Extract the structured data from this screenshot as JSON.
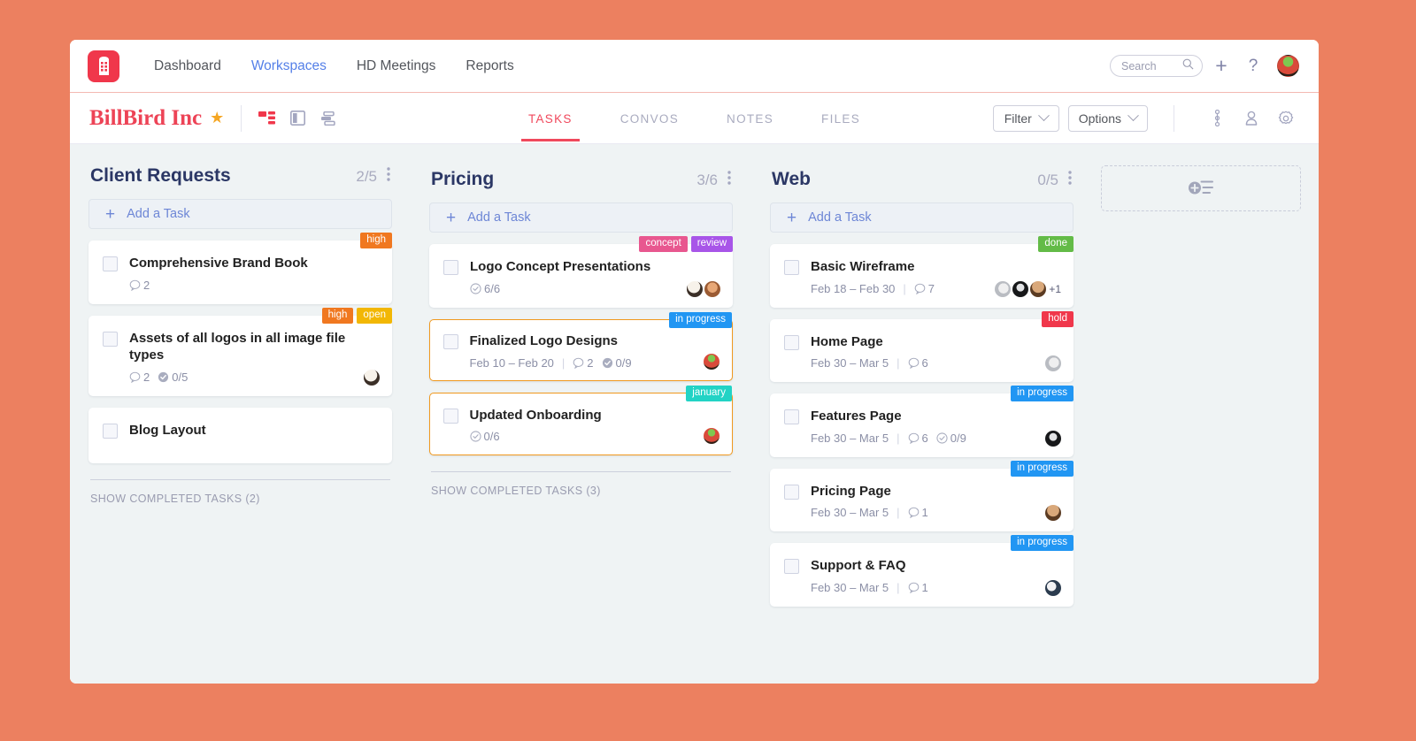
{
  "topnav": {
    "logo_icon": "building-logo-icon",
    "links": [
      {
        "label": "Dashboard",
        "active": false
      },
      {
        "label": "Workspaces",
        "active": true
      },
      {
        "label": "HD Meetings",
        "active": false
      },
      {
        "label": "Reports",
        "active": false
      }
    ],
    "search_placeholder": "Search",
    "add_label": "+",
    "help_label": "?"
  },
  "workspace": {
    "title": "BillBird Inc",
    "star": "★",
    "view_icons": [
      "board-view-icon",
      "split-view-icon",
      "list-view-icon"
    ],
    "tabs": [
      {
        "label": "TASKS",
        "active": true
      },
      {
        "label": "CONVOS",
        "active": false
      },
      {
        "label": "NOTES",
        "active": false
      },
      {
        "label": "FILES",
        "active": false
      }
    ],
    "filter_label": "Filter",
    "options_label": "Options"
  },
  "colors": {
    "brand_red": "#ed4356",
    "accent_orange": "#f0991f",
    "page_bg": "#ec8060",
    "board_bg": "#eff3f4",
    "link_blue": "#6d86d6",
    "tag_high": "#f07820",
    "tag_open": "#f2b705",
    "tag_concept": "#e8578f",
    "tag_review": "#a855e8",
    "tag_in_progress": "#2196f3",
    "tag_january": "#22d3c5",
    "tag_done": "#63bb47",
    "tag_hold": "#f0374b"
  },
  "columns": [
    {
      "title": "Client Requests",
      "count": "2/5",
      "add_task_label": "Add a Task",
      "show_completed": "SHOW COMPLETED TASKS (2)",
      "cards": [
        {
          "title": "Comprehensive Brand Book",
          "tags": [
            {
              "label": "high",
              "color": "#f07820"
            }
          ],
          "dates": "",
          "comments": "2",
          "subtasks": "",
          "highlight": false,
          "avatars": []
        },
        {
          "title": "Assets of all logos in all image file types",
          "tags": [
            {
              "label": "high",
              "color": "#f07820"
            },
            {
              "label": "open",
              "color": "#f2b705"
            }
          ],
          "dates": "",
          "comments": "2",
          "subtasks": "0/5",
          "highlight": false,
          "avatars": [
            "av-a"
          ]
        },
        {
          "title": "Blog Layout",
          "tags": [],
          "dates": "",
          "comments": "",
          "subtasks": "",
          "highlight": false,
          "avatars": []
        }
      ]
    },
    {
      "title": "Pricing",
      "count": "3/6",
      "add_task_label": "Add a Task",
      "show_completed": "SHOW COMPLETED TASKS (3)",
      "cards": [
        {
          "title": "Logo Concept Presentations",
          "tags": [
            {
              "label": "concept",
              "color": "#e8578f"
            },
            {
              "label": "review",
              "color": "#a855e8"
            }
          ],
          "dates": "",
          "comments": "",
          "subtasks": "6/6",
          "highlight": false,
          "avatars": [
            "av-a",
            "av-b"
          ]
        },
        {
          "title": "Finalized Logo Designs",
          "tags": [
            {
              "label": "in progress",
              "color": "#2196f3"
            }
          ],
          "dates": "Feb 10 – Feb 20",
          "comments": "2",
          "subtasks": "0/9",
          "highlight": true,
          "avatars": [
            "av-c"
          ]
        },
        {
          "title": "Updated Onboarding",
          "tags": [
            {
              "label": "january",
              "color": "#22d3c5"
            }
          ],
          "dates": "",
          "comments": "",
          "subtasks": "0/6",
          "highlight": true,
          "avatars": [
            "av-c"
          ]
        }
      ]
    },
    {
      "title": "Web",
      "count": "0/5",
      "add_task_label": "Add a Task",
      "show_completed": "",
      "cards": [
        {
          "title": "Basic Wireframe",
          "tags": [
            {
              "label": "done",
              "color": "#63bb47"
            }
          ],
          "dates": "Feb 18 – Feb 30",
          "comments": "7",
          "subtasks": "",
          "highlight": false,
          "avatars": [
            "av-d",
            "av-e",
            "av-f"
          ],
          "avatar_overflow": "+1"
        },
        {
          "title": "Home Page",
          "tags": [
            {
              "label": "hold",
              "color": "#f0374b"
            }
          ],
          "dates": "Feb 30 – Mar 5",
          "comments": "6",
          "subtasks": "",
          "highlight": false,
          "avatars": [
            "av-d"
          ]
        },
        {
          "title": "Features Page",
          "tags": [
            {
              "label": "in progress",
              "color": "#2196f3"
            }
          ],
          "dates": "Feb 30 – Mar 5",
          "comments": "6",
          "subtasks": "0/9",
          "highlight": false,
          "avatars": [
            "av-e"
          ]
        },
        {
          "title": "Pricing Page",
          "tags": [
            {
              "label": "in progress",
              "color": "#2196f3"
            }
          ],
          "dates": "Feb 30 – Mar 5",
          "comments": "1",
          "subtasks": "",
          "highlight": false,
          "avatars": [
            "av-f"
          ]
        },
        {
          "title": "Support & FAQ",
          "tags": [
            {
              "label": "in progress",
              "color": "#2196f3"
            }
          ],
          "dates": "Feb 30 – Mar 5",
          "comments": "1",
          "subtasks": "",
          "highlight": false,
          "avatars": [
            "av-g"
          ]
        }
      ]
    }
  ],
  "add_list": {
    "icon": "add-list-icon"
  }
}
